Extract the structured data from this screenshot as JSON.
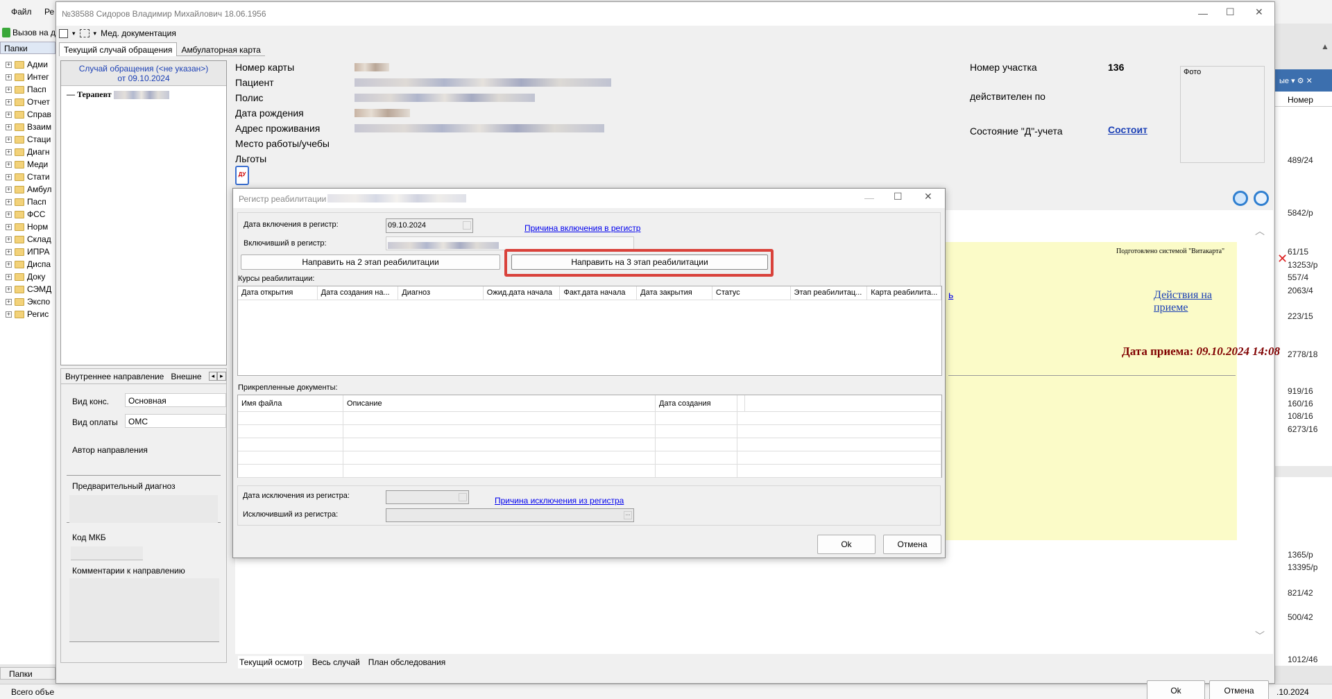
{
  "outer": {
    "menu": [
      "Файл",
      "Ре"
    ],
    "toolbar_call": "Вызов на д",
    "folders_tab": "Папки",
    "folders_bottom_tab": "Папки",
    "status_left": "Всего объе",
    "status_date": ".10.2024",
    "tree": [
      "Адми",
      "Интег",
      "Пасп",
      "Отчет",
      "Справ",
      "Взаим",
      "Стаци",
      "Диагн",
      "Меди",
      "Стати",
      "Амбул",
      "Пасп",
      "ФСС",
      "Норм",
      "Склад",
      "ИПРА",
      "Диспа",
      "Доку",
      "СЭМД",
      "Экспо",
      "Регис"
    ],
    "right_header_number": "Номер",
    "right_header_combo": "ые",
    "right_rows": [
      "489/24",
      "5842/р",
      "61/15",
      "13253/р",
      "557/4",
      "2063/4",
      "223/15",
      "2778/18",
      "919/16",
      "160/16",
      "108/16",
      "6273/16",
      "1365/р",
      "13395/р",
      "821/42",
      "500/42",
      "1012/46"
    ]
  },
  "patient_window": {
    "title": "№38588 Сидоров Владимир Михайлович 18.06.1956",
    "toolbar_med": "Мед. документация",
    "tabs": [
      "Текущий случай обращения",
      "Амбулаторная карта"
    ],
    "case_line1": "Случай обращения (<не указан>)",
    "case_line2": "от 09.10.2024",
    "case_doctor": "Терапевт",
    "fields": [
      "Номер карты",
      "Пациент",
      "Полис",
      "Дата рождения",
      "Адрес проживания",
      "Место работы/учебы",
      "Льготы"
    ],
    "uchastok_label": "Номер участка",
    "uchastok_value": "136",
    "valid_label": "действителен по",
    "d_state_label": "Состояние \"Д\"-учета",
    "d_state_link": "Состоит",
    "photo_label": "Фото",
    "du_icon_text": "ДУ",
    "direction_tabs": [
      "Внутреннее направление",
      "Внешне"
    ],
    "vid_kons_label": "Вид конс.",
    "vid_kons_value": "Основная",
    "vid_oplaty_label": "Вид оплаты",
    "vid_oplaty_value": "ОМС",
    "author_label": "Автор направления",
    "prelim_label": "Предварительный диагноз",
    "mkb_label": "Код МКБ",
    "comment_label": "Комментарии к направлению",
    "prepared_by": "Подготовлено системой \"Витакарта\"",
    "actions_link": "Действия на приеме",
    "link_fragment": "ь",
    "reception_label": "Дата приема:",
    "reception_value": "09.10.2024 14:08",
    "bottom_tabs": [
      "Текущий осмотр",
      "Весь случай",
      "План обследования"
    ],
    "ok": "Ok",
    "cancel": "Отмена"
  },
  "dialog": {
    "title": "Регистр реабилитации",
    "include_date_label": "Дата включения в регистр:",
    "include_date_value": "09.10.2024",
    "include_reason_link": "Причина включения в регистр",
    "included_by_label": "Включивший в регистр:",
    "btn_stage2": "Направить на 2 этап реабилитации",
    "btn_stage3": "Направить на 3 этап реабилитации",
    "courses_label": "Курсы реабилитации:",
    "courses_columns": [
      "Дата открытия",
      "Дата создания на...",
      "Диагноз",
      "Ожид.дата начала",
      "Факт.дата начала",
      "Дата закрытия",
      "Статус",
      "Этап реабилитац...",
      "Карта реабилита..."
    ],
    "docs_label": "Прикрепленные документы:",
    "docs_columns": [
      "Имя файла",
      "Описание",
      "Дата создания"
    ],
    "exclude_date_label": "Дата исключения из регистра:",
    "exclude_reason_link": "Причина исключения из регистра",
    "excluded_by_label": "Исключивший из регистра:",
    "ok": "Ok",
    "cancel": "Отмена"
  },
  "colors": {
    "highlight": "#d9423b",
    "link": "#0000ee",
    "yellow_panel": "#fbfbc8",
    "reception": "#800000"
  }
}
